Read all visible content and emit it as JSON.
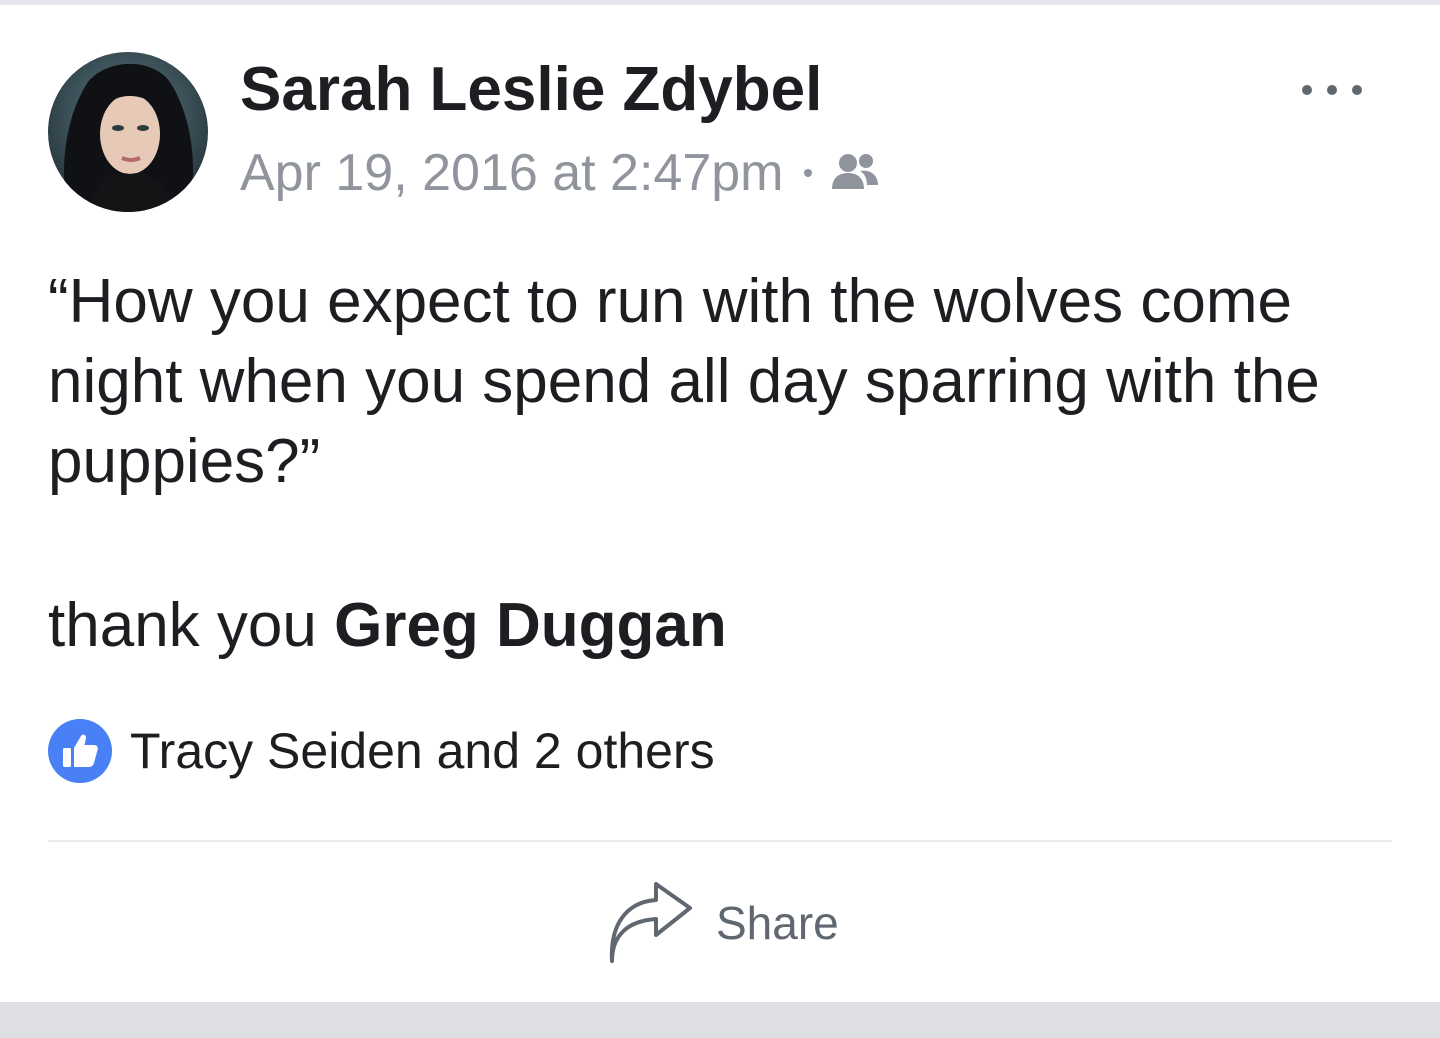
{
  "post": {
    "author": "Sarah Leslie Zdybel",
    "timestamp": "Apr 19, 2016 at 2:47pm",
    "audience_icon": "friends-icon",
    "body": "“How you expect to run with the wolves come night when you spend all day sparring with the puppies?”",
    "thanks_prefix": "thank you",
    "thanks_name": "Greg Duggan"
  },
  "reactions": {
    "icon": "like-icon",
    "summary": "Tracy Seiden and 2 others"
  },
  "actions": {
    "share_label": "Share",
    "share_icon": "share-arrow-icon",
    "more_icon": "more-options-icon"
  },
  "colors": {
    "like_blue": "#4a80f5",
    "meta_gray": "#90949c",
    "text": "#1c1e21"
  }
}
